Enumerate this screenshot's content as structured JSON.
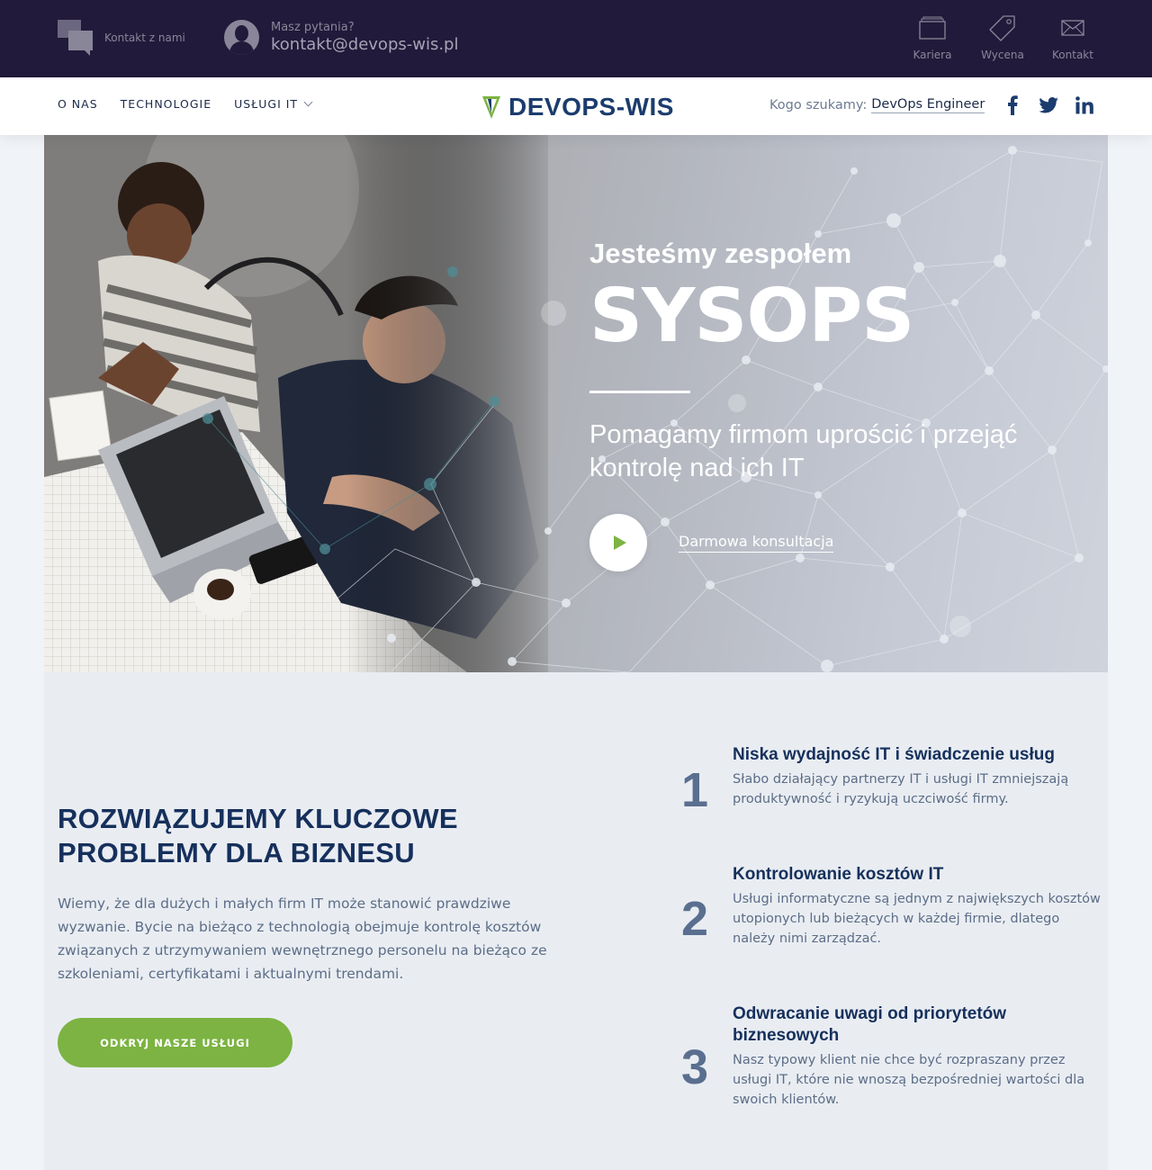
{
  "topbar": {
    "contact_label": "Kontakt z nami",
    "question_label": "Masz pytania?",
    "email": "kontakt@devops-wis.pl",
    "links": [
      {
        "label": "Kariera",
        "icon": "briefcase-icon"
      },
      {
        "label": "Wycena",
        "icon": "price-tag-icon"
      },
      {
        "label": "Kontakt",
        "icon": "envelope-icon"
      }
    ]
  },
  "nav": {
    "items": [
      "O NAS",
      "TECHNOLOGIE",
      "USŁUGI IT"
    ],
    "logo_text": "DEVOPS-WIS",
    "seek_label": "Kogo szukamy:",
    "seek_value": "DevOps Engineer",
    "socials": [
      "facebook-icon",
      "twitter-icon",
      "linkedin-icon"
    ]
  },
  "hero": {
    "pre_title": "Jesteśmy zespołem",
    "main_title": "SYSOPS",
    "subtitle": "Pomagamy firmom uprościć i przejąć kontrolę nad ich IT",
    "cta_label": "Darmowa konsultacja"
  },
  "section": {
    "title": "ROZWIĄZUJEMY KLUCZOWE PROBLEMY DLA BIZNESU",
    "text": "Wiemy, że dla dużych i małych firm IT może stanowić prawdziwe wyzwanie. Bycie na bieżąco z technologią obejmuje kontrolę kosztów związanych z utrzymywaniem wewnętrznego personelu na bieżąco ze szkoleniami, certyfikatami i aktualnymi trendami.",
    "button": "ODKRYJ NASZE USŁUGI",
    "problems": [
      {
        "num": "1",
        "title": "Niska wydajność IT i świadczenie usług",
        "desc": "Słabo działający partnerzy IT i usługi IT zmniejszają produktywność i ryzykują uczciwość firmy."
      },
      {
        "num": "2",
        "title": "Kontrolowanie kosztów IT",
        "desc": "Usługi informatyczne są jednym z największych kosztów utopionych lub bieżących w każdej firmie, dlatego należy nimi zarządzać."
      },
      {
        "num": "3",
        "title": "Odwracanie uwagi od priorytetów biznesowych",
        "desc": "Nasz typowy klient nie chce być rozpraszany przez usługi IT, które nie wnoszą bezpośredniej wartości dla swoich klientów."
      }
    ]
  },
  "colors": {
    "accent": "#7cb342",
    "navy": "#16305c",
    "topbar": "#221a3a"
  }
}
